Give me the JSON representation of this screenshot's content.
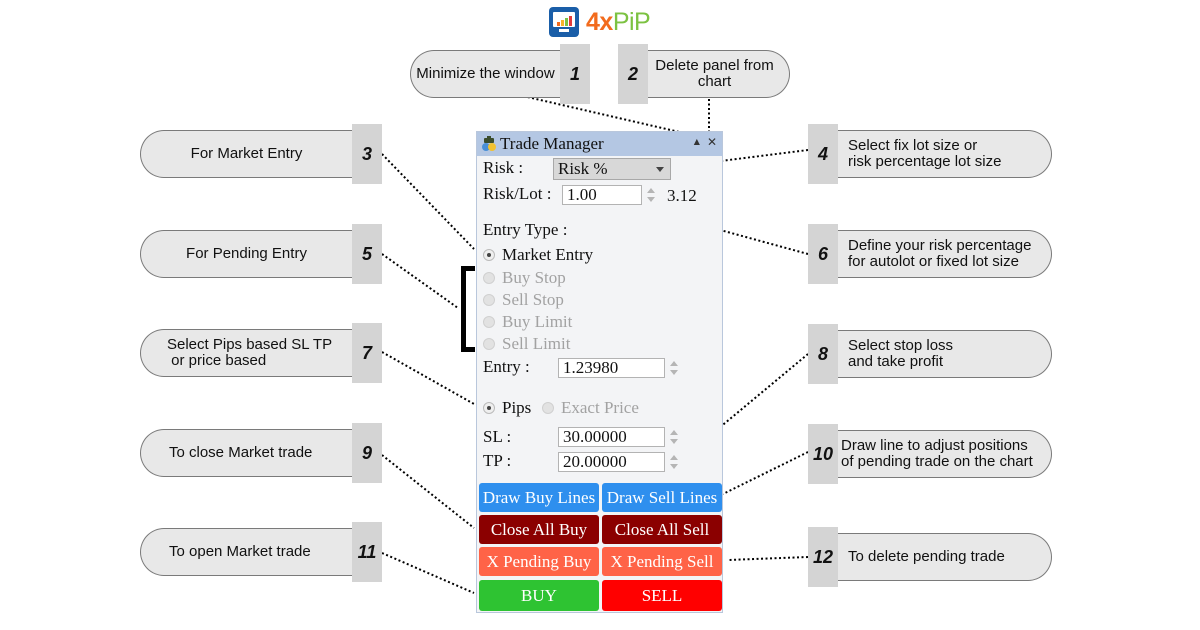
{
  "logo": {
    "brand_part1": "4x",
    "brand_part2": "PiP",
    "icon": "monitor-chart-icon"
  },
  "panel": {
    "title": "Trade Manager",
    "title_icon": "trade-manager-icon",
    "minimize_icon": "▲",
    "close_icon": "✕",
    "risk_label": "Risk :",
    "risk_select_value": "Risk %",
    "risk_lot_label": "Risk/Lot :",
    "risk_lot_value": "1.00",
    "computed_lot": "3.12",
    "entry_type_label": "Entry Type :",
    "entry_types": [
      {
        "label": "Market Entry",
        "selected": true,
        "enabled": true
      },
      {
        "label": "Buy Stop",
        "selected": false,
        "enabled": false
      },
      {
        "label": "Sell Stop",
        "selected": false,
        "enabled": false
      },
      {
        "label": "Buy Limit",
        "selected": false,
        "enabled": false
      },
      {
        "label": "Sell Limit",
        "selected": false,
        "enabled": false
      }
    ],
    "entry_label": "Entry :",
    "entry_value": "1.23980",
    "sltp_modes": [
      {
        "label": "Pips",
        "selected": true,
        "enabled": true
      },
      {
        "label": "Exact Price",
        "selected": false,
        "enabled": false
      }
    ],
    "sl_label": "SL :",
    "sl_value": "30.00000",
    "tp_label": "TP :",
    "tp_value": "20.00000",
    "buttons": {
      "draw_buy_lines": "Draw Buy Lines",
      "draw_sell_lines": "Draw Sell Lines",
      "close_all_buy": "Close All Buy",
      "close_all_sell": "Close All Sell",
      "x_pending_buy": "X Pending Buy",
      "x_pending_sell": "X Pending Sell",
      "buy": "BUY",
      "sell": "SELL"
    },
    "colors": {
      "titlebar": "#b4c7e3",
      "draw_lines": "#2e8fee",
      "close_all": "#8b0000",
      "x_pending": "#ff6347",
      "buy": "#2ec332",
      "sell": "#ff0000"
    }
  },
  "callouts": [
    {
      "number": "1",
      "text": "Minimize the window"
    },
    {
      "number": "2",
      "text": "Delete panel from chart"
    },
    {
      "number": "3",
      "text": "For Market Entry"
    },
    {
      "number": "4",
      "text_line1": "Select fix lot size or",
      "text_line2": "risk percentage lot size"
    },
    {
      "number": "5",
      "text": "For Pending Entry"
    },
    {
      "number": "6",
      "text_line1": "Define your risk percentage",
      "text_line2": "for autolot or fixed lot size"
    },
    {
      "number": "7",
      "text_line1": "Select Pips based SL TP",
      "text_line2": " or price based"
    },
    {
      "number": "8",
      "text_line1": "Select stop loss",
      "text_line2": "and take profit"
    },
    {
      "number": "9",
      "text": "To close Market trade"
    },
    {
      "number": "10",
      "text_line1": "Draw line to adjust positions",
      "text_line2": "of pending trade on the chart"
    },
    {
      "number": "11",
      "text": "To open Market trade"
    },
    {
      "number": "12",
      "text": "To delete pending trade"
    }
  ]
}
